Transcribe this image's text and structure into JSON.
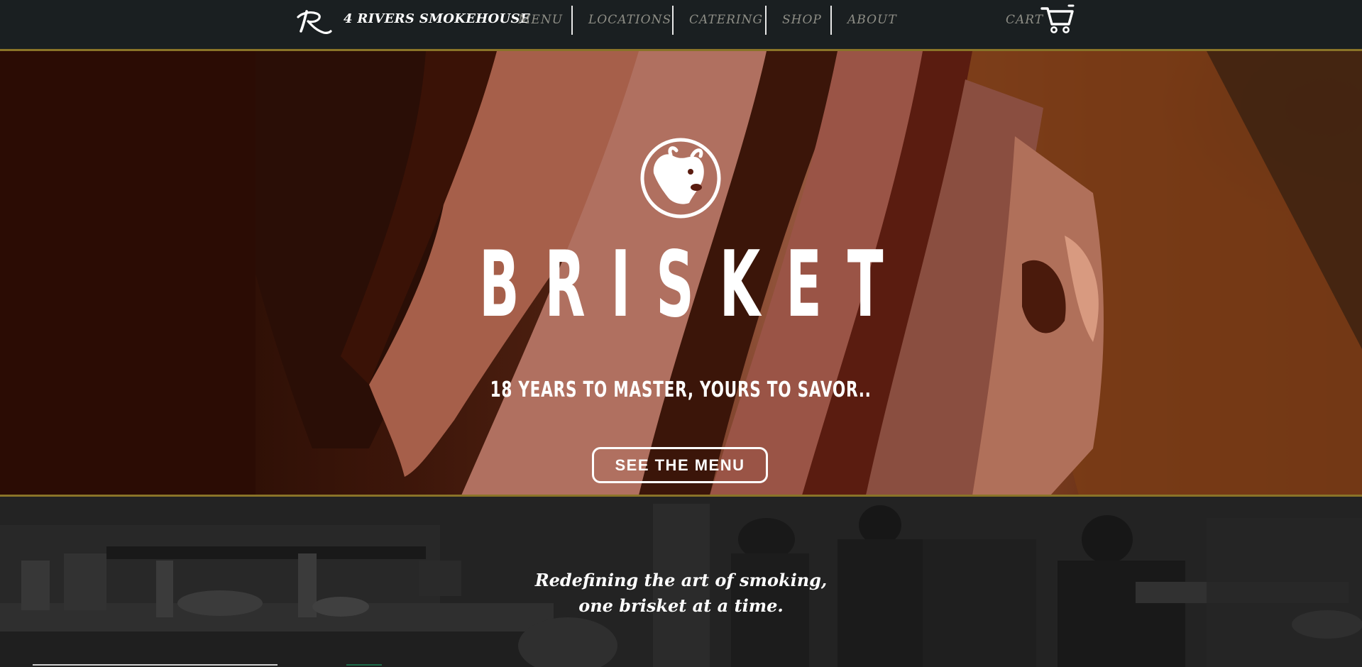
{
  "nav": {
    "brand": "4 RIVERS SMOKEHOUSE",
    "items": [
      {
        "label": "MENU"
      },
      {
        "label": "LOCATIONS"
      },
      {
        "label": "CATERING"
      },
      {
        "label": "SHOP"
      },
      {
        "label": "ABOUT"
      }
    ],
    "cart_label": "CART"
  },
  "hero": {
    "title": "BRISKET",
    "subtitle": "18 YEARS TO MASTER, YOURS TO SAVOR..",
    "button_label": "SEE THE MENU"
  },
  "strip": {
    "tagline_line1": "Redefining the art of smoking,",
    "tagline_line2": "one brisket at a time."
  },
  "colors": {
    "nav_bg": "#1a1f21",
    "accent_gold": "#8a7428",
    "nav_text": "#8e8e86",
    "white": "#ffffff"
  },
  "icons": {
    "logo": "r-logo-icon",
    "cart": "shopping-cart-icon",
    "hero_logo": "cow-head-emblem-icon"
  }
}
